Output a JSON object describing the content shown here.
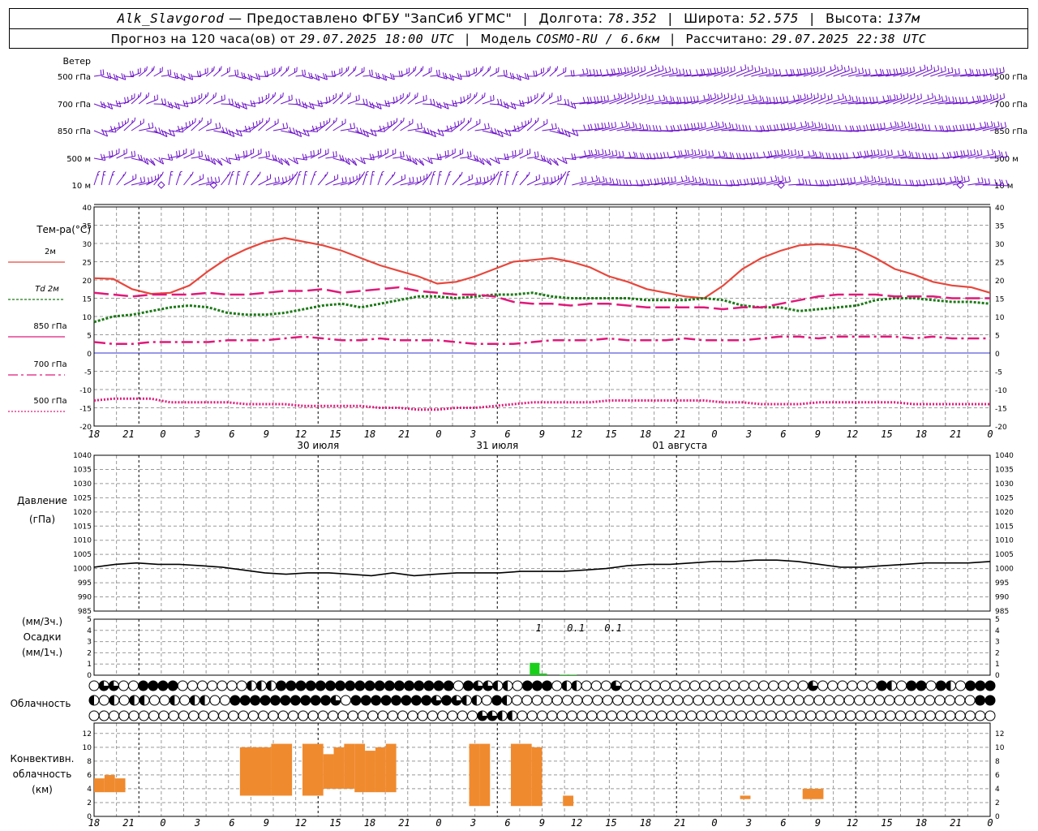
{
  "header": {
    "station": "Alk_Slavgorod",
    "dash": "—",
    "provider": "Предоставлено ФГБУ \"ЗапСиб УГМС\"",
    "lon_label": "Долгота:",
    "lon_value": "78.352",
    "lat_label": "Широта:",
    "lat_value": "52.575",
    "alt_label": "Высота:",
    "alt_value": "137м",
    "forecast_label": "Прогноз на 120 часа(ов) от",
    "forecast_start": "29.07.2025 18:00 UTC",
    "model_label": "Модель",
    "model_value": "COSMO-RU / 6.6км",
    "calc_label": "Рассчитано:",
    "calc_value": "29.07.2025 22:38 UTC"
  },
  "labels": {
    "wind": "Ветер",
    "wind_levels": [
      "500 гПа",
      "700 гПа",
      "850 гПа",
      "500 м",
      "10 м"
    ],
    "temp": "Тем-ра(°C)",
    "temp_legend": [
      "2м",
      "Td 2м",
      "850 гПа",
      "700 гПа",
      "500 гПа"
    ],
    "pressure": [
      "Давление",
      "(гПа)"
    ],
    "precip": [
      "(мм/3ч.)",
      "Осадки",
      "(мм/1ч.)"
    ],
    "cloud": "Облачность",
    "conv": [
      "Конвективн.",
      "облачность",
      "(км)"
    ]
  },
  "time_ticks": [
    "18",
    "21",
    "0",
    "3",
    "6",
    "9",
    "12",
    "15",
    "18",
    "21",
    "0",
    "3",
    "6",
    "9",
    "12",
    "15",
    "18",
    "21",
    "0",
    "3",
    "6",
    "9",
    "12",
    "15",
    "18",
    "21",
    "0"
  ],
  "day_labels": [
    "30 июля",
    "31 июля",
    "01 августа"
  ],
  "colors": {
    "t2m": "#e8473c",
    "td2m": "#1c7a16",
    "t850": "#e0197a",
    "t700": "#e0197a",
    "t500": "#e0197a",
    "wind": "#6a10c8",
    "precip": "#19d019",
    "conv": "#f08a2e",
    "zero_line": "#3030d0"
  },
  "chart_data": [
    {
      "type": "line",
      "title": "Тем-ра(°C)",
      "xlabel": "часы UTC",
      "ylabel": "°C",
      "ylim": [
        -20,
        40
      ],
      "x": [
        0,
        3,
        6,
        9,
        12,
        15,
        18,
        21,
        24,
        27,
        30,
        33,
        36,
        39,
        42,
        45,
        48,
        51,
        54,
        57,
        60,
        63,
        66,
        69,
        72,
        75,
        78,
        81,
        84,
        87,
        90,
        93,
        96,
        99,
        102,
        105,
        108,
        111,
        114,
        117,
        120
      ],
      "series": [
        {
          "name": "2м",
          "values": [
            20.5,
            20.3,
            17.5,
            16.2,
            16.5,
            18.5,
            22.5,
            26,
            28.5,
            30.5,
            31.5,
            30.5,
            29.5,
            28,
            26,
            24,
            22.5,
            21,
            19,
            19.5,
            21,
            23,
            25,
            25.5,
            26,
            25,
            23.5,
            21,
            19.5,
            17.5,
            16.5,
            15.5,
            15,
            18.5,
            23,
            26,
            28,
            29.5,
            29.8,
            29.5,
            28.5,
            26,
            23,
            21.5,
            19.5,
            18.5,
            18,
            16.5
          ]
        },
        {
          "name": "Td 2м",
          "values": [
            8.5,
            10,
            10.5,
            11.5,
            12.5,
            13,
            12.5,
            11,
            10.5,
            10.5,
            11,
            12,
            13,
            13.5,
            12.5,
            13.5,
            14.5,
            15.5,
            15.5,
            15,
            15.5,
            16,
            16,
            16.5,
            15.5,
            15,
            15,
            15,
            15,
            14.5,
            14.5,
            14.5,
            15,
            14.5,
            13,
            12.5,
            12.5,
            11.5,
            12,
            12.5,
            13,
            14.5,
            15,
            15,
            14.5,
            14,
            14,
            13.5
          ]
        },
        {
          "name": "850 гПа",
          "values": [
            16.5,
            16,
            15.5,
            16,
            16,
            16,
            16.5,
            16,
            16,
            16.5,
            17,
            17,
            17.5,
            16.5,
            17,
            17.5,
            18,
            17,
            16.5,
            16,
            16,
            15.5,
            14,
            13.5,
            13.5,
            13,
            13.5,
            13.5,
            13,
            12.5,
            12.5,
            12.5,
            12.5,
            12,
            12.5,
            12.5,
            13.5,
            14.5,
            15.5,
            16,
            16,
            16,
            15.5,
            15.5,
            15.5,
            15,
            15,
            15
          ]
        },
        {
          "name": "700 гПа",
          "values": [
            3,
            2.5,
            2.5,
            3,
            3,
            3,
            3,
            3.5,
            3.5,
            3.5,
            4,
            4.5,
            4,
            3.5,
            3.5,
            4,
            3.5,
            3.5,
            3.5,
            3,
            2.5,
            2.5,
            2.5,
            3,
            3.5,
            3.5,
            3.5,
            4,
            3.5,
            3.5,
            3.5,
            4,
            3.5,
            3.5,
            3.5,
            4,
            4.5,
            4.5,
            4,
            4.5,
            4.5,
            4.5,
            4.5,
            4,
            4.5,
            4,
            4,
            4
          ]
        },
        {
          "name": "500 гПа",
          "values": [
            -13,
            -12.5,
            -12.5,
            -12.5,
            -13.5,
            -13.5,
            -13.5,
            -13.5,
            -14,
            -14,
            -14,
            -14.5,
            -14.5,
            -14.5,
            -14.5,
            -15,
            -15,
            -15.5,
            -15.5,
            -15,
            -15,
            -14.5,
            -14,
            -13.5,
            -13.5,
            -13.5,
            -13.5,
            -13,
            -13,
            -13,
            -13,
            -13,
            -13,
            -13.5,
            -13.5,
            -14,
            -14,
            -14,
            -13.5,
            -13.5,
            -13.5,
            -13.5,
            -13.5,
            -14,
            -14,
            -14,
            -14,
            -14
          ]
        }
      ]
    },
    {
      "type": "line",
      "title": "Давление (гПа)",
      "ylabel": "гПа",
      "ylim": [
        985,
        1040
      ],
      "x": [
        0,
        3,
        6,
        9,
        12,
        15,
        18,
        21,
        24,
        27,
        30,
        33,
        36,
        39,
        42,
        45,
        48,
        51,
        54,
        57,
        60,
        63,
        66,
        69,
        72,
        75,
        78,
        81,
        84,
        87,
        90,
        93,
        96,
        99,
        102,
        105,
        108,
        111,
        114,
        117,
        120
      ],
      "series": [
        {
          "name": "Давление",
          "values": [
            1000.5,
            1001.5,
            1002,
            1001.5,
            1001.5,
            1001,
            1000.5,
            999.5,
            998.5,
            998,
            998.5,
            998.5,
            998,
            997.5,
            998.5,
            997.5,
            998,
            998.5,
            998.5,
            998.5,
            999,
            999,
            999,
            999.5,
            1000,
            1001,
            1001.5,
            1001.5,
            1002,
            1002.5,
            1002.5,
            1003,
            1003,
            1002.5,
            1001.5,
            1000.5,
            1000.5,
            1001,
            1001.5,
            1002,
            1002,
            1002,
            1002.5
          ]
        }
      ]
    },
    {
      "type": "bar",
      "title": "Осадки",
      "ylabel": "мм/1ч.",
      "ylim": [
        0,
        5
      ],
      "x_hours": [
        59,
        60,
        63,
        64
      ],
      "values": [
        1.1,
        0.15,
        0.05,
        0.05
      ],
      "annotations": [
        {
          "x_hour": 58,
          "text": "1"
        },
        {
          "x_hour": 63,
          "text": "0.1"
        },
        {
          "x_hour": 68,
          "text": "0.1"
        }
      ]
    },
    {
      "type": "bar",
      "title": "Конвективн. облачность (км)",
      "ylabel": "км",
      "ylim": [
        0,
        13
      ],
      "ranges": [
        {
          "x0": 0,
          "x1": 1,
          "bottom": 3.5,
          "top": 5.5
        },
        {
          "x0": 1,
          "x1": 2,
          "bottom": 3.5,
          "top": 6
        },
        {
          "x0": 2,
          "x1": 3,
          "bottom": 3.5,
          "top": 5.5
        },
        {
          "x0": 14,
          "x1": 17,
          "bottom": 3,
          "top": 10
        },
        {
          "x0": 17,
          "x1": 19,
          "bottom": 3,
          "top": 10.5
        },
        {
          "x0": 20,
          "x1": 22,
          "bottom": 3,
          "top": 10.5
        },
        {
          "x0": 22,
          "x1": 23,
          "bottom": 4,
          "top": 9
        },
        {
          "x0": 23,
          "x1": 24,
          "bottom": 4,
          "top": 10
        },
        {
          "x0": 24,
          "x1": 25,
          "bottom": 4,
          "top": 10.5
        },
        {
          "x0": 25,
          "x1": 26,
          "bottom": 3.5,
          "top": 10.5
        },
        {
          "x0": 26,
          "x1": 27,
          "bottom": 3.5,
          "top": 9.5
        },
        {
          "x0": 27,
          "x1": 28,
          "bottom": 3.5,
          "top": 10
        },
        {
          "x0": 28,
          "x1": 29,
          "bottom": 3.5,
          "top": 10.5
        },
        {
          "x0": 36,
          "x1": 37,
          "bottom": 1.5,
          "top": 10.5
        },
        {
          "x0": 37,
          "x1": 38,
          "bottom": 1.5,
          "top": 10.5
        },
        {
          "x0": 40,
          "x1": 42,
          "bottom": 1.5,
          "top": 10.5
        },
        {
          "x0": 42,
          "x1": 43,
          "bottom": 1.5,
          "top": 10
        },
        {
          "x0": 45,
          "x1": 46,
          "bottom": 1.5,
          "top": 3
        },
        {
          "x0": 62,
          "x1": 63,
          "bottom": 2.5,
          "top": 3
        },
        {
          "x0": 68,
          "x1": 70,
          "bottom": 2.5,
          "top": 4
        }
      ]
    }
  ],
  "cloud_rows": [
    "0qq00ffff0000000hhhffffffffffffffffff0fqqhh0fff0hh000q0000000000000000000q000000fh0ff0fh0fff",
    "h0h0hh00h0hh00ffffffffffq0ffffffffqfqhh0fh0000000000000000000000000000000000000000000000ff",
    "000000000000000000000000000000000000000qqhh000000000000000000000000000000000000000000000000"
  ]
}
